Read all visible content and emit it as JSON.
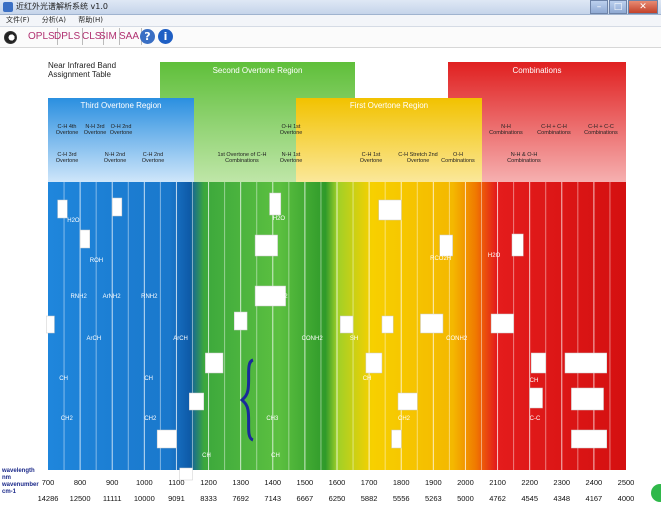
{
  "window": {
    "title": "近红外光谱解析系统 v1.0",
    "min": "–",
    "max": "□",
    "close": "✕"
  },
  "menu": [
    "文件(F)",
    "分析(A)",
    "帮助(H)"
  ],
  "toolbar": {
    "items": [
      "OPLS",
      "DPLS",
      "CLS",
      "SIM",
      "SAA"
    ]
  },
  "chart_data": {
    "type": "table",
    "title": "Near Infrared Band Assignment Table",
    "wavelength_label": "wavelength nm wavenumber cm-1",
    "regions": [
      {
        "name": "Third Overtone Region",
        "color": "#2a8fe0"
      },
      {
        "name": "Second Overtone Region",
        "color": "#5fbf3a"
      },
      {
        "name": "First Overtone Region",
        "color": "#f2c200"
      },
      {
        "name": "Combinations",
        "color": "#e02020"
      }
    ],
    "wavelengths": [
      700,
      800,
      900,
      1000,
      1100,
      1200,
      1300,
      1400,
      1500,
      1600,
      1700,
      1800,
      1900,
      2000,
      2100,
      2200,
      2300,
      2400,
      2500
    ],
    "wavenumbers": [
      14286,
      12500,
      11111,
      10000,
      9091,
      8333,
      7692,
      7143,
      6667,
      6250,
      5882,
      5556,
      5263,
      5000,
      4762,
      4545,
      4348,
      4167,
      4000
    ],
    "header_labels": [
      "C-H 4th Overtone",
      "N-H 3rd Overtone",
      "O-H 2nd Overtone",
      "C-H 3rd Overtone",
      "N-H 2nd Overtone",
      "C-H 2nd Overtone",
      "1st Overtone of C-H Combinations",
      "O-H 1st Overtone",
      "N-H 1st Overtone",
      "C-H 1st Overtone",
      "C-H Stretch 2nd Overtone",
      "O-H Combinations",
      "N-H Combinations",
      "C-H + C-H Combinations",
      "C-H + C-C Combinations",
      "N-H & O-H Combinations"
    ],
    "band_labels": [
      "H2O",
      "ROH",
      "ArOH",
      "RNH2",
      "ArNH2",
      "ArCH",
      "CH",
      "CH2",
      "CH3",
      "RCO2H",
      "CONH2",
      "SH",
      "C-C"
    ]
  }
}
